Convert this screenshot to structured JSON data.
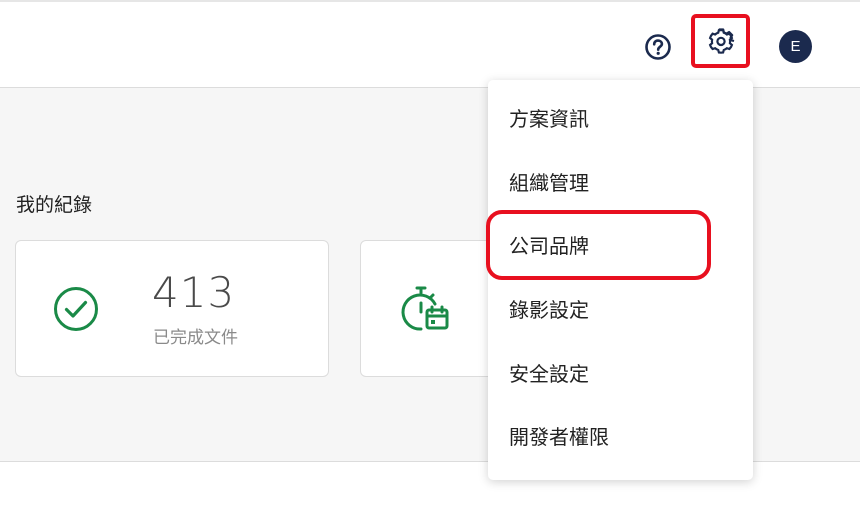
{
  "header": {
    "help_icon": "question-circle-icon",
    "settings_icon": "gear-icon",
    "avatar_initial": "E"
  },
  "records": {
    "title": "我的紀錄",
    "cards": [
      {
        "icon": "check-circle-icon",
        "value": "413",
        "label": "已完成文件"
      },
      {
        "icon": "stopwatch-calendar-icon"
      }
    ]
  },
  "settings_menu": {
    "items": [
      {
        "label": "方案資訊"
      },
      {
        "label": "組織管理"
      },
      {
        "label": "公司品牌"
      },
      {
        "label": "錄影設定"
      },
      {
        "label": "安全設定"
      },
      {
        "label": "開發者權限"
      }
    ]
  },
  "colors": {
    "accent_red": "#e8101f",
    "avatar_bg": "#1b2a4e",
    "green": "#1a8a47",
    "page_bg": "#f6f6f6"
  }
}
